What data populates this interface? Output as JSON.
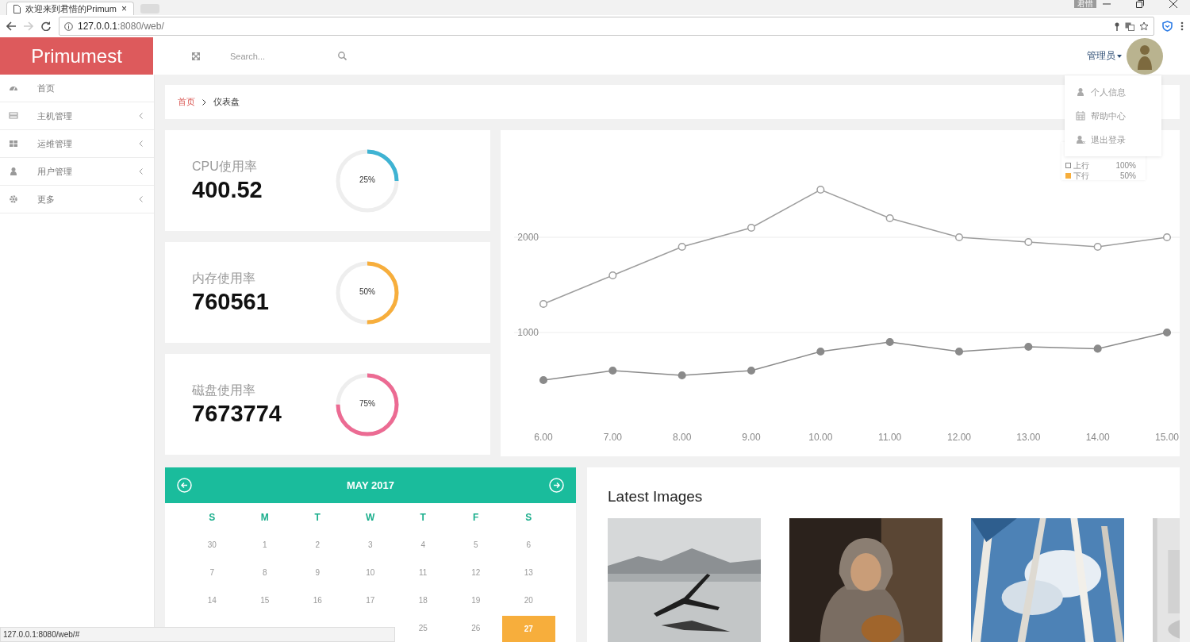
{
  "browser": {
    "tab_title": "欢迎来到君惜的Primum",
    "tab_close": "×",
    "url_host": "127.0.0.1",
    "url_rest": ":8080/web/",
    "profile": "君惜",
    "status_url": "127.0.0.1:8080/web/#"
  },
  "header": {
    "logo": "Primumest",
    "search": {
      "placeholder": "Search..."
    },
    "user": "管理员"
  },
  "user_menu": [
    {
      "label": "个人信息"
    },
    {
      "label": "帮助中心"
    },
    {
      "label": "退出登录"
    }
  ],
  "sidebar": {
    "items": [
      {
        "label": "首页",
        "has_submenu": false
      },
      {
        "label": "主机管理",
        "has_submenu": true
      },
      {
        "label": "运维管理",
        "has_submenu": true
      },
      {
        "label": "用户管理",
        "has_submenu": true
      },
      {
        "label": "更多",
        "has_submenu": true
      }
    ]
  },
  "breadcrumb": [
    {
      "label": "首页",
      "current": false
    },
    {
      "label": "仪表盘",
      "current": true
    }
  ],
  "stats": [
    {
      "label": "CPU使用率",
      "value": "400.52",
      "level": 0.25,
      "reading": "25%",
      "color": "#3fb3d3"
    },
    {
      "label": "内存使用率",
      "value": "760561",
      "level": 0.5,
      "reading": "50%",
      "color": "#f7ae3c"
    },
    {
      "label": "磁盘使用率",
      "value": "7673774",
      "level": 0.75,
      "reading": "75%",
      "color": "#ec6b93"
    }
  ],
  "traffic": {
    "legend": [
      {
        "value": "100%",
        "kind": "hollow",
        "color": "#888888"
      },
      {
        "value": "50%",
        "kind": "filled",
        "color": "#f7ae3c"
      }
    ],
    "chart_data": {
      "type": "line",
      "categories": [
        "6.00",
        "7.00",
        "8.00",
        "9.00",
        "10.00",
        "11.00",
        "12.00",
        "13.00",
        "14.00",
        "15.00"
      ],
      "ylim": [
        -300,
        3125
      ],
      "yticks": [
        1000,
        2000
      ],
      "series": [
        {
          "name": "上行",
          "color": "#9e9e9e",
          "marker": "circle",
          "values": [
            1300,
            1600,
            1900,
            2100,
            2500,
            2200,
            2000,
            1950,
            1900,
            2000
          ]
        },
        {
          "name": "下行",
          "color": "#8a8a8a",
          "marker": "circle",
          "values": [
            500,
            600,
            550,
            600,
            800,
            900,
            800,
            850,
            830,
            1000
          ]
        }
      ]
    }
  },
  "calendar": {
    "title": "MAY 2017",
    "weekdays": [
      "S",
      "M",
      "T",
      "W",
      "T",
      "F",
      "S"
    ],
    "weeks": [
      [
        {
          "day": "30",
          "selected": false
        },
        {
          "day": "1",
          "selected": false
        },
        {
          "day": "2",
          "selected": false
        },
        {
          "day": "3",
          "selected": false
        },
        {
          "day": "4",
          "selected": false
        },
        {
          "day": "5",
          "selected": false
        },
        {
          "day": "6",
          "selected": false
        }
      ],
      [
        {
          "day": "7",
          "selected": false
        },
        {
          "day": "8",
          "selected": false
        },
        {
          "day": "9",
          "selected": false
        },
        {
          "day": "10",
          "selected": false
        },
        {
          "day": "11",
          "selected": false
        },
        {
          "day": "12",
          "selected": false
        },
        {
          "day": "13",
          "selected": false
        }
      ],
      [
        {
          "day": "14",
          "selected": false
        },
        {
          "day": "15",
          "selected": false
        },
        {
          "day": "16",
          "selected": false
        },
        {
          "day": "17",
          "selected": false
        },
        {
          "day": "18",
          "selected": false
        },
        {
          "day": "19",
          "selected": false
        },
        {
          "day": "20",
          "selected": false
        }
      ],
      [
        {
          "day": "25",
          "selected": false
        },
        {
          "day": "26",
          "selected": false
        },
        {
          "day": "27",
          "selected": true
        }
      ]
    ]
  },
  "images": {
    "title": "Latest Images"
  }
}
